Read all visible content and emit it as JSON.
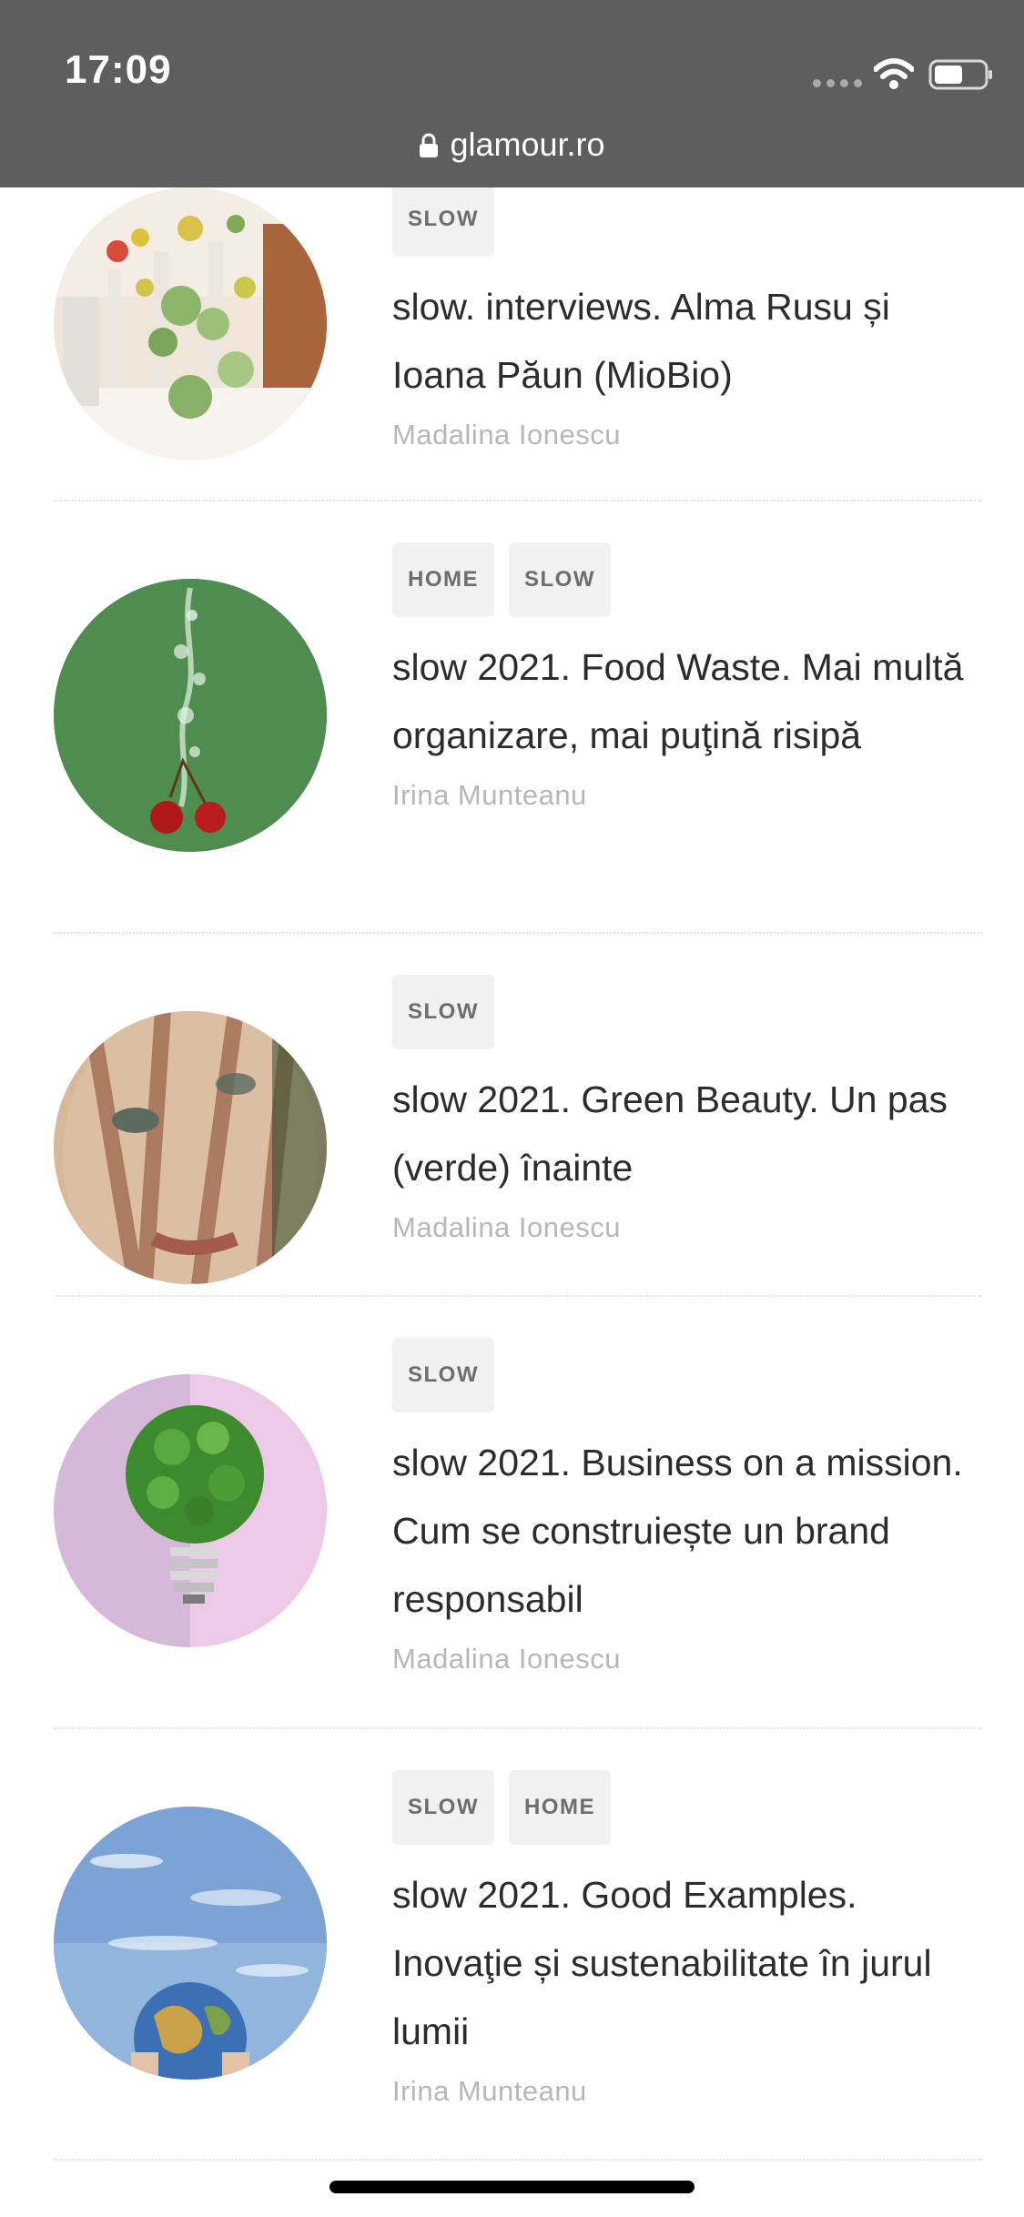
{
  "status_bar": {
    "time": "17:09",
    "url": "glamour.ro",
    "lock_icon": "lock-icon",
    "wifi_icon": "wifi-icon",
    "battery_icon": "battery-icon"
  },
  "articles": [
    {
      "tags": [
        "SLOW"
      ],
      "title": "slow. interviews. Alma Rusu și Ioana Păun (MioBio)",
      "author": "Madalina Ionescu",
      "image": "flowers-table-photo"
    },
    {
      "tags": [
        "HOME",
        "SLOW"
      ],
      "title": "slow 2021. Food Waste. Mai multă organizare, mai puţină risipă",
      "author": "Irina Munteanu",
      "image": "cherries-in-water-photo"
    },
    {
      "tags": [
        "SLOW"
      ],
      "title": "slow 2021. Green Beauty. Un pas (verde) înainte",
      "author": "Madalina Ionescu",
      "image": "woman-face-shadow-photo"
    },
    {
      "tags": [
        "SLOW"
      ],
      "title": "slow 2021. Business on a mission. Cum se construiește un brand responsabil",
      "author": "Madalina Ionescu",
      "image": "green-lightbulb-photo"
    },
    {
      "tags": [
        "SLOW",
        "HOME"
      ],
      "title": "slow 2021. Good Examples. Inovaţie și sustenabilitate în jurul lumii",
      "author": "Irina Munteanu",
      "image": "globe-in-hands-photo"
    }
  ],
  "colors": {
    "top_bar": "#5e5e5e",
    "tag_bg": "#f1f1f1",
    "tag_text": "#6d6d6d",
    "title": "#2c2c2c",
    "author": "#b7b7b7"
  }
}
